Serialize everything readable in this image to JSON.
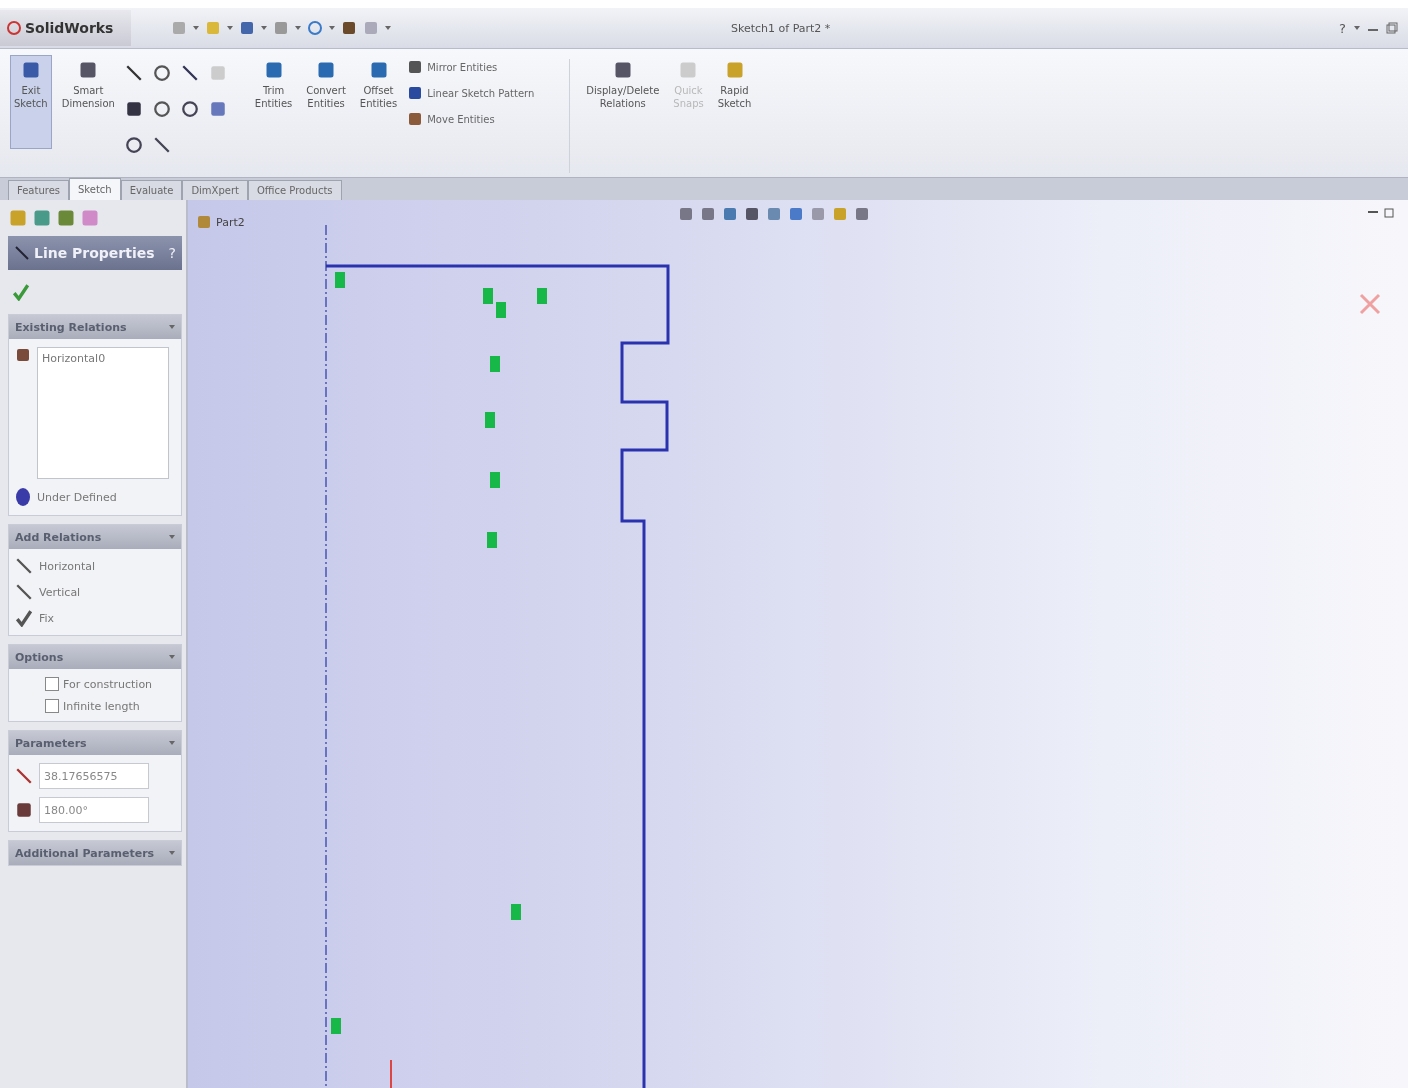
{
  "title_bar": {
    "logo": "SolidWorks",
    "title": "Sketch1 of Part2 *",
    "help": "?"
  },
  "ribbon": {
    "big_buttons": [
      {
        "label": "Exit Sketch",
        "selected": true
      },
      {
        "label": "Smart Dimension",
        "selected": false
      }
    ],
    "tool_buttons": [
      {
        "label": "Trim Entities",
        "disabled": false
      },
      {
        "label": "Convert Entities",
        "disabled": false
      },
      {
        "label": "Offset Entities",
        "disabled": false
      }
    ],
    "list_buttons": [
      "Mirror Entities",
      "Linear Sketch Pattern",
      "Move Entities"
    ],
    "right_buttons": [
      {
        "label": "Display/Delete Relations",
        "disabled": false
      },
      {
        "label": "Quick Snaps",
        "disabled": true
      },
      {
        "label": "Rapid Sketch",
        "disabled": false
      }
    ]
  },
  "tabs": [
    {
      "label": "Features",
      "selected": false
    },
    {
      "label": "Sketch",
      "selected": true
    },
    {
      "label": "Evaluate",
      "selected": false
    },
    {
      "label": "DimXpert",
      "selected": false
    },
    {
      "label": "Office Products",
      "selected": false
    }
  ],
  "tree": {
    "root": "Part2"
  },
  "property_manager": {
    "title": "Line Properties",
    "help": "?",
    "existing_relations": {
      "heading": "Existing Relations",
      "items": [
        "Horizontal0"
      ],
      "status": "Under Defined"
    },
    "add_relations": {
      "heading": "Add Relations",
      "items": [
        "Horizontal",
        "Vertical",
        "Fix"
      ]
    },
    "options": {
      "heading": "Options",
      "items": [
        {
          "label": "For construction",
          "checked": false
        },
        {
          "label": "Infinite length",
          "checked": false
        }
      ]
    },
    "parameters": {
      "heading": "Parameters",
      "length": "38.17656575",
      "angle": "180.00°"
    },
    "additional": {
      "heading": "Additional Parameters"
    }
  }
}
